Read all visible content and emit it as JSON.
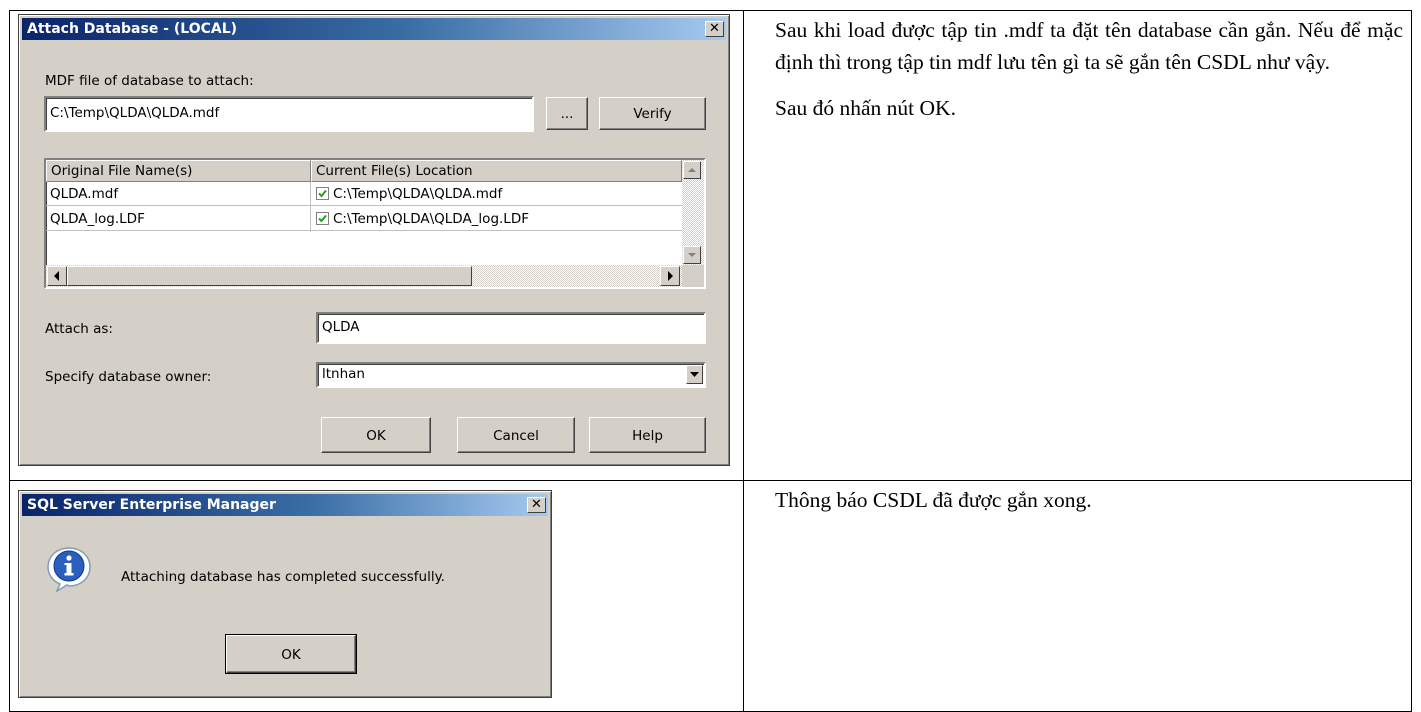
{
  "doc": {
    "paragraph1": "Sau khi load được tập tin .mdf ta đặt tên database cần gắn. Nếu để mặc định thì trong tập tin mdf lưu tên gì ta sẽ gắn tên CSDL như vậy.",
    "paragraph2": "Sau đó nhấn nút OK.",
    "paragraph3": "Thông báo CSDL đã được gắn xong."
  },
  "attach_dialog": {
    "title": "Attach Database - (LOCAL)",
    "mdf_label": "MDF file of database to attach:",
    "mdf_value": "C:\\Temp\\QLDA\\QLDA.mdf",
    "browse_label": "...",
    "verify_label": "Verify",
    "columns": [
      "Original File Name(s)",
      "Current File(s) Location"
    ],
    "rows": [
      {
        "name": "QLDA.mdf",
        "location": "C:\\Temp\\QLDA\\QLDA.mdf",
        "checked": true
      },
      {
        "name": "QLDA_log.LDF",
        "location": "C:\\Temp\\QLDA\\QLDA_log.LDF",
        "checked": true
      }
    ],
    "attach_as_label": "Attach as:",
    "attach_as_value": "QLDA",
    "owner_label": "Specify database owner:",
    "owner_value": "ltnhan",
    "ok_label": "OK",
    "cancel_label": "Cancel",
    "help_label": "Help"
  },
  "message_box": {
    "title": "SQL Server Enterprise Manager",
    "message": "Attaching database has completed successfully.",
    "ok_label": "OK"
  },
  "icons": {
    "close": "close-icon",
    "info": "info-icon",
    "check": "checkbox-checked-icon"
  },
  "colors": {
    "titlebar_start": "#0a246a",
    "titlebar_end": "#a6caf0",
    "dialog_face": "#d4d0c8",
    "check_green": "#21a121"
  }
}
